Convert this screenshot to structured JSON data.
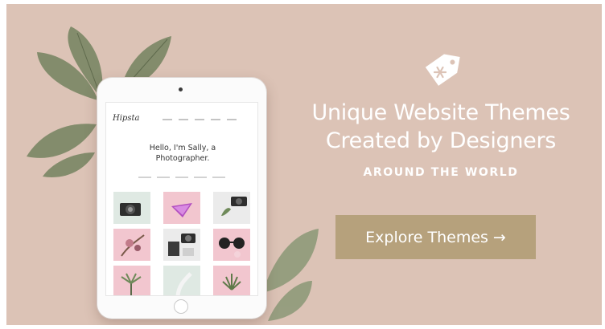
{
  "banner": {
    "headline_line1": "Unique Website Themes",
    "headline_line2": "Created by Designers",
    "subline": "AROUND THE WORLD",
    "cta_label": "Explore Themes",
    "cta_arrow": "→",
    "tag_icon": "price-tag-icon",
    "colors": {
      "background": "#dcc3b6",
      "button": "#b6a17c",
      "text": "#ffffff"
    }
  },
  "tablet": {
    "site_logo": "Hipsta",
    "heading": "Hello, I'm Sally, a\nPhotographer."
  }
}
